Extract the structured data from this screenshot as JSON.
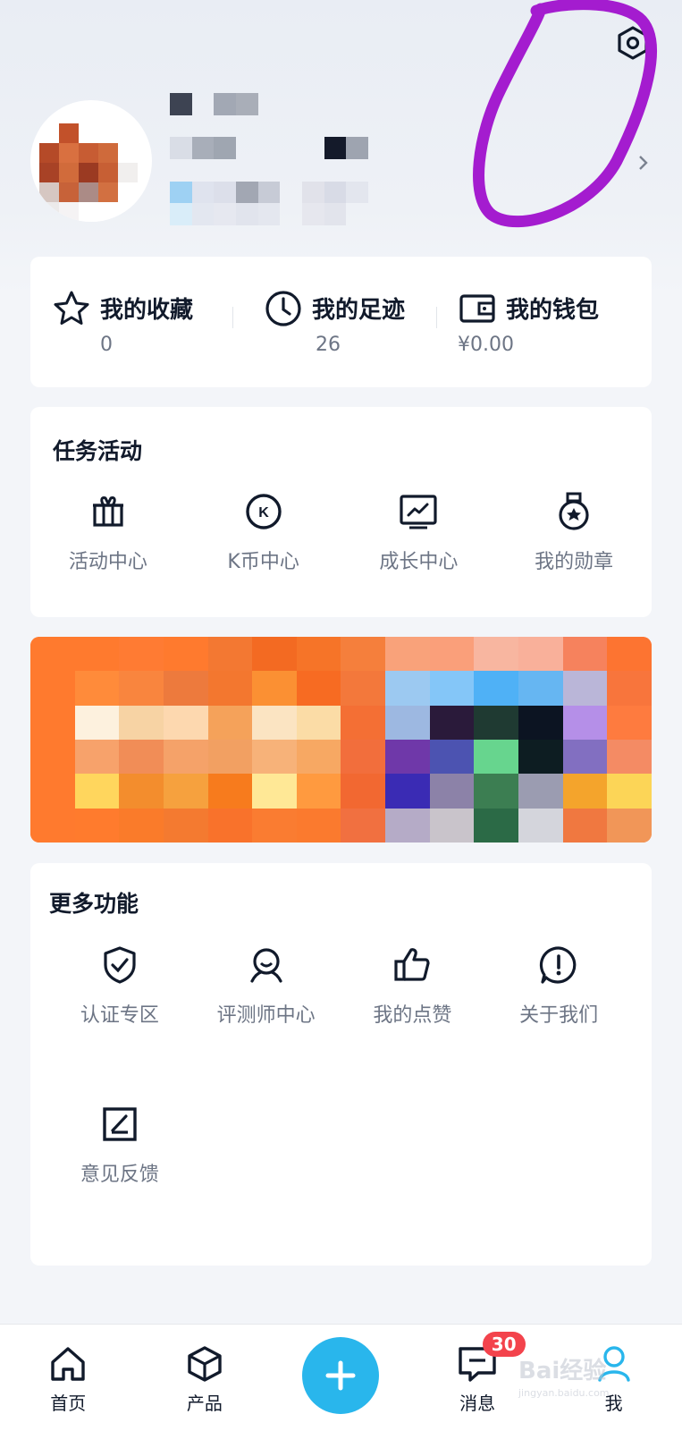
{
  "stats": [
    {
      "label": "我的收藏",
      "value": "0",
      "icon": "star-icon"
    },
    {
      "label": "我的足迹",
      "value": "26",
      "icon": "clock-icon"
    },
    {
      "label": "我的钱包",
      "value": "¥0.00",
      "icon": "wallet-icon"
    }
  ],
  "tasks": {
    "title": "任务活动",
    "items": [
      {
        "label": "活动中心",
        "icon": "gift-icon"
      },
      {
        "label": "K币中心",
        "icon": "k-coin-icon"
      },
      {
        "label": "成长中心",
        "icon": "growth-chart-icon"
      },
      {
        "label": "我的勋章",
        "icon": "medal-icon"
      }
    ]
  },
  "more": {
    "title": "更多功能",
    "items": [
      {
        "label": "认证专区",
        "icon": "shield-check-icon"
      },
      {
        "label": "评测师中心",
        "icon": "reviewer-icon"
      },
      {
        "label": "我的点赞",
        "icon": "thumbs-up-icon"
      },
      {
        "label": "关于我们",
        "icon": "info-alert-icon"
      },
      {
        "label": "意见反馈",
        "icon": "feedback-edit-icon"
      }
    ]
  },
  "tabbar": {
    "items": [
      {
        "label": "首页",
        "icon": "home-icon"
      },
      {
        "label": "产品",
        "icon": "cube-icon"
      },
      {
        "label": "",
        "icon": "plus-icon"
      },
      {
        "label": "消息",
        "icon": "message-icon",
        "badge": "30"
      },
      {
        "label": "我",
        "icon": "user-icon"
      }
    ]
  },
  "watermark": {
    "text": "Bai经验",
    "sub": "jingyan.baidu.com"
  },
  "colors": {
    "accent": "#29b6ec",
    "badge": "#f3434c",
    "annotation": "#a41ccf"
  }
}
